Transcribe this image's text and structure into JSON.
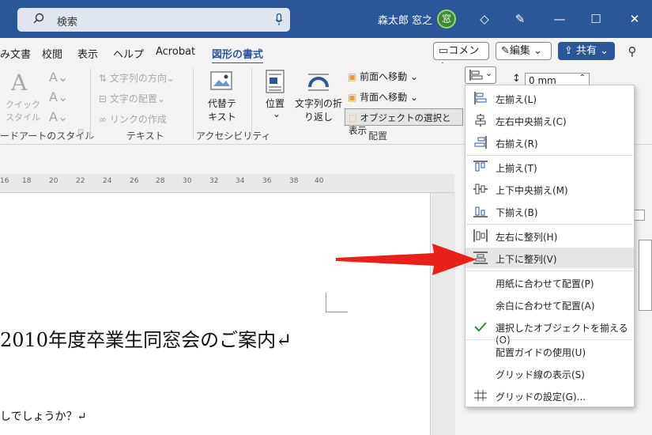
{
  "titlebar": {
    "search_label": "検索",
    "user_name": "森太郎 窓之",
    "avatar_char": "窓"
  },
  "menubar": {
    "tabs": [
      "み文書",
      "校閲",
      "表示",
      "ヘルプ",
      "Acrobat",
      "図形の書式"
    ],
    "comment_label": "コメント",
    "edit_label": "編集",
    "share_label": "共有"
  },
  "ribbon": {
    "wordart": {
      "quick_style": "クイック\nスタイル",
      "group_label": "ードアートのスタイル"
    },
    "text": {
      "direction": "文字列の方向",
      "align": "文字の配置",
      "link": "リンクの作成",
      "group_label": "テキスト"
    },
    "access": {
      "alt_text": "代替テ\nキスト",
      "group_label": "アクセシビリティ"
    },
    "arrange": {
      "position": "位置",
      "wrap": "文字列の折\nり返し",
      "forward": "前面へ移動",
      "backward": "背面へ移動",
      "selection_pane": "オブジェクトの選択と表示",
      "group_label": "配置"
    },
    "size": {
      "height_value": "0 mm"
    }
  },
  "ruler": {
    "ticks": [
      "16",
      "18",
      "20",
      "22",
      "24",
      "26",
      "28",
      "30",
      "32",
      "34",
      "36",
      "38",
      "40"
    ]
  },
  "document": {
    "title": "2010年度卒業生同窓会のご案内↵",
    "line1": "しでしょうか？↵"
  },
  "align_menu": {
    "items": [
      {
        "label": "左揃え(L)",
        "icon": "align-left-icon"
      },
      {
        "label": "左右中央揃え(C)",
        "icon": "align-center-icon"
      },
      {
        "label": "右揃え(R)",
        "icon": "align-right-icon"
      },
      {
        "label": "上揃え(T)",
        "icon": "align-top-icon"
      },
      {
        "label": "上下中央揃え(M)",
        "icon": "align-middle-icon"
      },
      {
        "label": "下揃え(B)",
        "icon": "align-bottom-icon"
      },
      {
        "label": "左右に整列(H)",
        "icon": "distribute-horizontal-icon"
      },
      {
        "label": "上下に整列(V)",
        "icon": "distribute-vertical-icon"
      },
      {
        "label": "用紙に合わせて配置(P)",
        "icon": ""
      },
      {
        "label": "余白に合わせて配置(A)",
        "icon": ""
      },
      {
        "label": "選択したオブジェクトを揃える(O)",
        "icon": "check-icon"
      },
      {
        "label": "配置ガイドの使用(U)",
        "icon": ""
      },
      {
        "label": "グリッド線の表示(S)",
        "icon": ""
      },
      {
        "label": "グリッドの設定(G)...",
        "icon": "grid-icon"
      }
    ]
  },
  "colors": {
    "accent": "#2b579a",
    "arrow": "#e8201a",
    "check": "#2e8b3d"
  }
}
